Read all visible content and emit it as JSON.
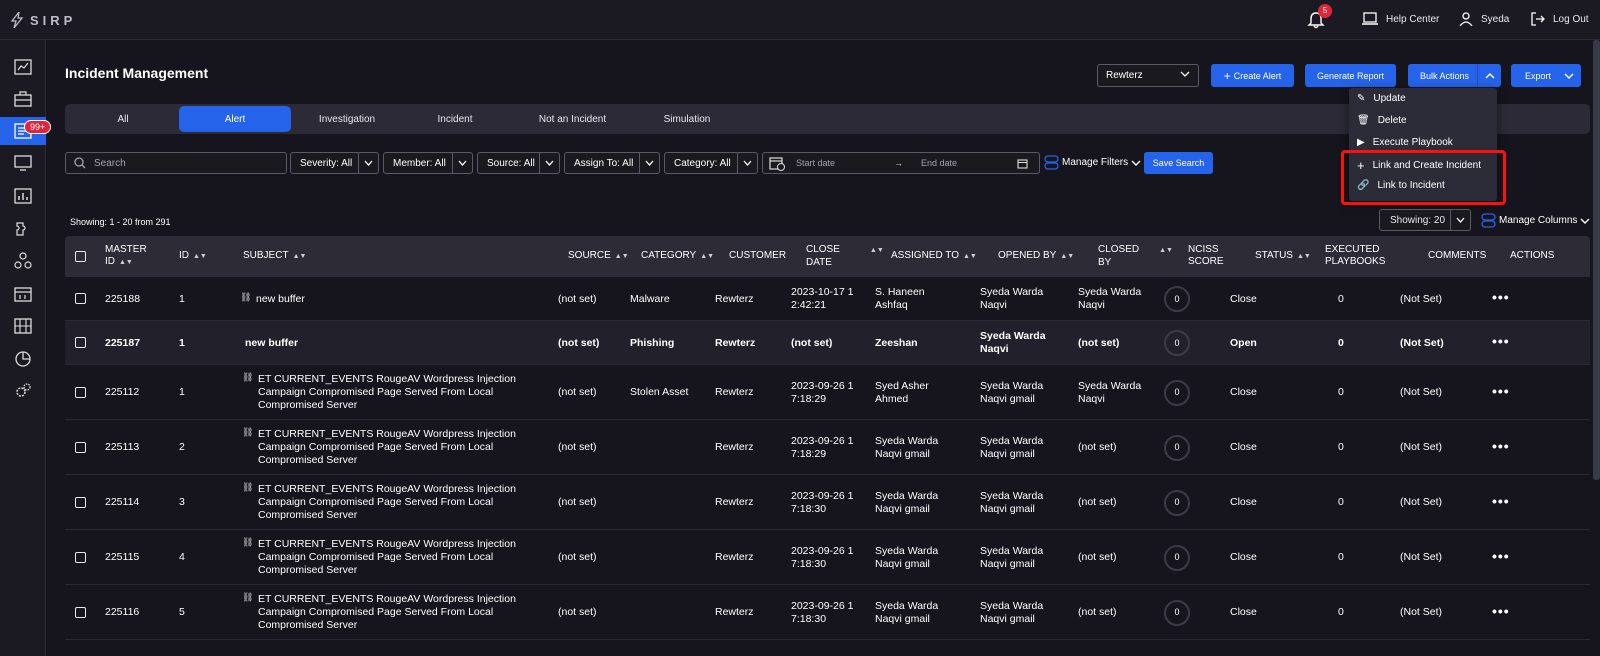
{
  "app": {
    "logo": "SIRP"
  },
  "topbar": {
    "notifications": "5",
    "help": "Help Center",
    "user": "Syeda",
    "logout": "Log Out"
  },
  "sidebar": {
    "badge": "99+"
  },
  "header": {
    "title": "Incident Management",
    "customer_select": "Rewterz",
    "create_alert": "Create Alert",
    "generate_report": "Generate Report",
    "bulk_actions": "Bulk Actions",
    "export": "Export"
  },
  "tabs": [
    {
      "label": "All"
    },
    {
      "label": "Alert"
    },
    {
      "label": "Investigation"
    },
    {
      "label": "Incident"
    },
    {
      "label": "Not an Incident"
    },
    {
      "label": "Simulation"
    }
  ],
  "bulk_menu": [
    {
      "label": "Update",
      "icon": "pencil-icon"
    },
    {
      "label": "Delete",
      "icon": "trash-icon"
    },
    {
      "label": "Execute Playbook",
      "icon": "play-icon"
    },
    {
      "label": "Link and Create Incident",
      "icon": "plus-icon"
    },
    {
      "label": "Link to Incident",
      "icon": "link-icon"
    }
  ],
  "filters": {
    "search_placeholder": "Search",
    "severity": "Severity: All",
    "member": "Member: All",
    "source": "Source: All",
    "assign_to": "Assign To: All",
    "category": "Category: All",
    "start_date": "Start date",
    "end_date": "End date",
    "manage_filters": "Manage Filters",
    "save_search": "Save Search"
  },
  "list": {
    "showing_text": "Showing: 1 - 20 from 291",
    "page_size": "Showing: 20",
    "manage_columns": "Manage Columns"
  },
  "columns": {
    "master_id_1": "MASTER",
    "master_id_2": "ID",
    "id": "ID",
    "subject": "SUBJECT",
    "source": "SOURCE",
    "category": "CATEGORY",
    "customer": "CUSTOMER",
    "close_date_1": "CLOSE",
    "close_date_2": "DATE",
    "assigned_to": "ASSIGNED TO",
    "opened_by": "OPENED BY",
    "closed_by_1": "CLOSED",
    "closed_by_2": "BY",
    "nciss_1": "NCISS",
    "nciss_2": "SCORE",
    "status": "STATUS",
    "exec_1": "EXECUTED",
    "exec_2": "PLAYBOOKS",
    "comments": "COMMENTS",
    "actions": "ACTIONS"
  },
  "rows": [
    {
      "master_id": "225188",
      "id": "1",
      "subject": [
        "new buffer"
      ],
      "source": "(not set)",
      "category": "Malware",
      "customer": "Rewterz",
      "close_date": [
        "2023-10-17 1",
        "2:42:21"
      ],
      "assigned_to": [
        "S. Haneen",
        "Ashfaq"
      ],
      "opened_by": [
        "Syeda Warda",
        "Naqvi"
      ],
      "closed_by": [
        "Syeda Warda",
        "Naqvi"
      ],
      "score": "0",
      "status": "Close",
      "playbooks": "0",
      "comments": "(Not Set)"
    },
    {
      "master_id": "225187",
      "id": "1",
      "subject": [
        "new buffer"
      ],
      "source": "(not set)",
      "category": "Phishing",
      "customer": "Rewterz",
      "close_date": [
        "(not set)"
      ],
      "assigned_to": [
        "Zeeshan"
      ],
      "opened_by": [
        "Syeda Warda",
        "Naqvi"
      ],
      "closed_by": [
        "(not set)"
      ],
      "score": "0",
      "status": "Open",
      "playbooks": "0",
      "comments": "(Not Set)"
    },
    {
      "master_id": "225112",
      "id": "1",
      "subject": [
        "ET CURRENT_EVENTS RougeAV Wordpress Injection",
        "Campaign Compromised Page Served From Local",
        "Compromised Server"
      ],
      "source": "(not set)",
      "category": "Stolen Asset",
      "customer": "Rewterz",
      "close_date": [
        "2023-09-26 1",
        "7:18:29"
      ],
      "assigned_to": [
        "Syed Asher",
        "Ahmed"
      ],
      "opened_by": [
        "Syeda Warda",
        "Naqvi gmail"
      ],
      "closed_by": [
        "Syeda Warda",
        "Naqvi"
      ],
      "score": "0",
      "status": "Close",
      "playbooks": "0",
      "comments": "(Not Set)"
    },
    {
      "master_id": "225113",
      "id": "2",
      "subject": [
        "ET CURRENT_EVENTS RougeAV Wordpress Injection",
        "Campaign Compromised Page Served From Local",
        "Compromised Server"
      ],
      "source": "(not set)",
      "category": "",
      "customer": "Rewterz",
      "close_date": [
        "2023-09-26 1",
        "7:18:29"
      ],
      "assigned_to": [
        "Syeda Warda",
        "Naqvi gmail"
      ],
      "opened_by": [
        "Syeda Warda",
        "Naqvi gmail"
      ],
      "closed_by": [
        "(not set)"
      ],
      "score": "0",
      "status": "Close",
      "playbooks": "0",
      "comments": "(Not Set)"
    },
    {
      "master_id": "225114",
      "id": "3",
      "subject": [
        "ET CURRENT_EVENTS RougeAV Wordpress Injection",
        "Campaign Compromised Page Served From Local",
        "Compromised Server"
      ],
      "source": "(not set)",
      "category": "",
      "customer": "Rewterz",
      "close_date": [
        "2023-09-26 1",
        "7:18:30"
      ],
      "assigned_to": [
        "Syeda Warda",
        "Naqvi gmail"
      ],
      "opened_by": [
        "Syeda Warda",
        "Naqvi gmail"
      ],
      "closed_by": [
        "(not set)"
      ],
      "score": "0",
      "status": "Close",
      "playbooks": "0",
      "comments": "(Not Set)"
    },
    {
      "master_id": "225115",
      "id": "4",
      "subject": [
        "ET CURRENT_EVENTS RougeAV Wordpress Injection",
        "Campaign Compromised Page Served From Local",
        "Compromised Server"
      ],
      "source": "(not set)",
      "category": "",
      "customer": "Rewterz",
      "close_date": [
        "2023-09-26 1",
        "7:18:30"
      ],
      "assigned_to": [
        "Syeda Warda",
        "Naqvi gmail"
      ],
      "opened_by": [
        "Syeda Warda",
        "Naqvi gmail"
      ],
      "closed_by": [
        "(not set)"
      ],
      "score": "0",
      "status": "Close",
      "playbooks": "0",
      "comments": "(Not Set)"
    },
    {
      "master_id": "225116",
      "id": "5",
      "subject": [
        "ET CURRENT_EVENTS RougeAV Wordpress Injection",
        "Campaign Compromised Page Served From Local",
        "Compromised Server"
      ],
      "source": "(not set)",
      "category": "",
      "customer": "Rewterz",
      "close_date": [
        "2023-09-26 1",
        "7:18:30"
      ],
      "assigned_to": [
        "Syeda Warda",
        "Naqvi gmail"
      ],
      "opened_by": [
        "Syeda Warda",
        "Naqvi gmail"
      ],
      "closed_by": [
        "(not set)"
      ],
      "score": "0",
      "status": "Close",
      "playbooks": "0",
      "comments": "(Not Set)"
    }
  ]
}
